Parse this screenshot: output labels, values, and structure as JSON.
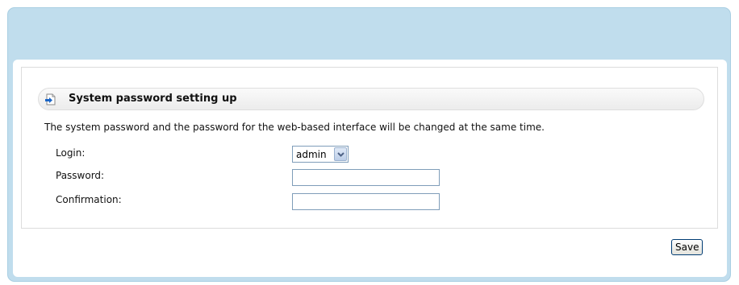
{
  "section": {
    "title": "System password setting up",
    "icon": "page-arrow-icon",
    "description": "The system password and the password for the web-based interface will be changed at the same time."
  },
  "form": {
    "login_label": "Login:",
    "login_value": "admin",
    "password_label": "Password:",
    "password_value": "",
    "confirmation_label": "Confirmation:",
    "confirmation_value": ""
  },
  "actions": {
    "save_label": "Save"
  },
  "colors": {
    "frame": "#c0dded",
    "accent": "#1a65c6"
  }
}
